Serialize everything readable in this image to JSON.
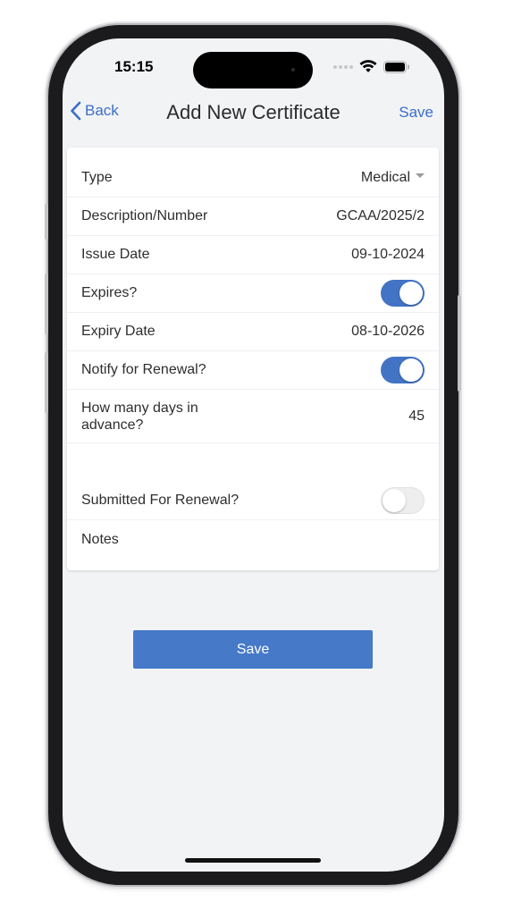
{
  "status_bar": {
    "time": "15:15"
  },
  "nav": {
    "back_label": "Back",
    "title": "Add New Certificate",
    "save_label": "Save"
  },
  "form": {
    "type": {
      "label": "Type",
      "value": "Medical"
    },
    "description": {
      "label": "Description/Number",
      "value": "GCAA/2025/2"
    },
    "issue_date": {
      "label": "Issue Date",
      "value": "09-10-2024"
    },
    "expires": {
      "label": "Expires?",
      "on": true
    },
    "expiry_date": {
      "label": "Expiry Date",
      "value": "08-10-2026"
    },
    "notify": {
      "label": "Notify for Renewal?",
      "on": true
    },
    "days_advance": {
      "label": "How many days in advance?",
      "value": "45"
    },
    "submitted": {
      "label": "Submitted For Renewal?",
      "on": false
    },
    "notes": {
      "label": "Notes",
      "value": ""
    }
  },
  "save_button_label": "Save",
  "colors": {
    "accent": "#4273c4",
    "link": "#3a6fc7",
    "background": "#f2f3f5"
  }
}
